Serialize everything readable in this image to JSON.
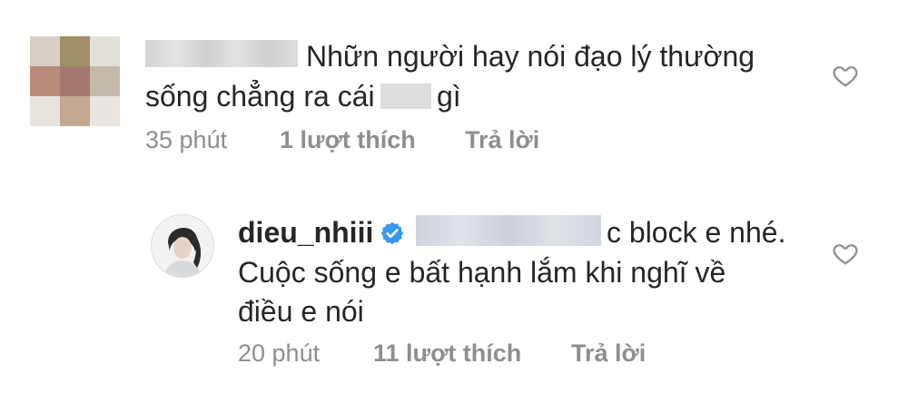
{
  "colors": {
    "text": "#262626",
    "meta": "#8e8e8e",
    "verified_badge": "#3897f0",
    "heart_outline": "#8e8e8e"
  },
  "comment1": {
    "text_line1": "Nhữn người hay nói đạo lý thường",
    "text_line2_pre": "sống chẳng ra cái",
    "text_line2_post": "gì",
    "time": "35 phút",
    "likes": "1 lượt thích",
    "reply_label": "Trả lời",
    "avatar_icon": "blurred-avatar",
    "like_icon": "heart-outline-icon"
  },
  "comment2": {
    "username": "dieu_nhiii",
    "verified_icon": "verified-badge-icon",
    "text_line1_post": "c block e nhé.",
    "text_line2": "Cuộc sống e bất hạnh lắm khi nghĩ về",
    "text_line3": "điều e nói",
    "time": "20 phút",
    "likes": "11 lượt thích",
    "reply_label": "Trả lời",
    "like_icon": "heart-outline-icon"
  }
}
